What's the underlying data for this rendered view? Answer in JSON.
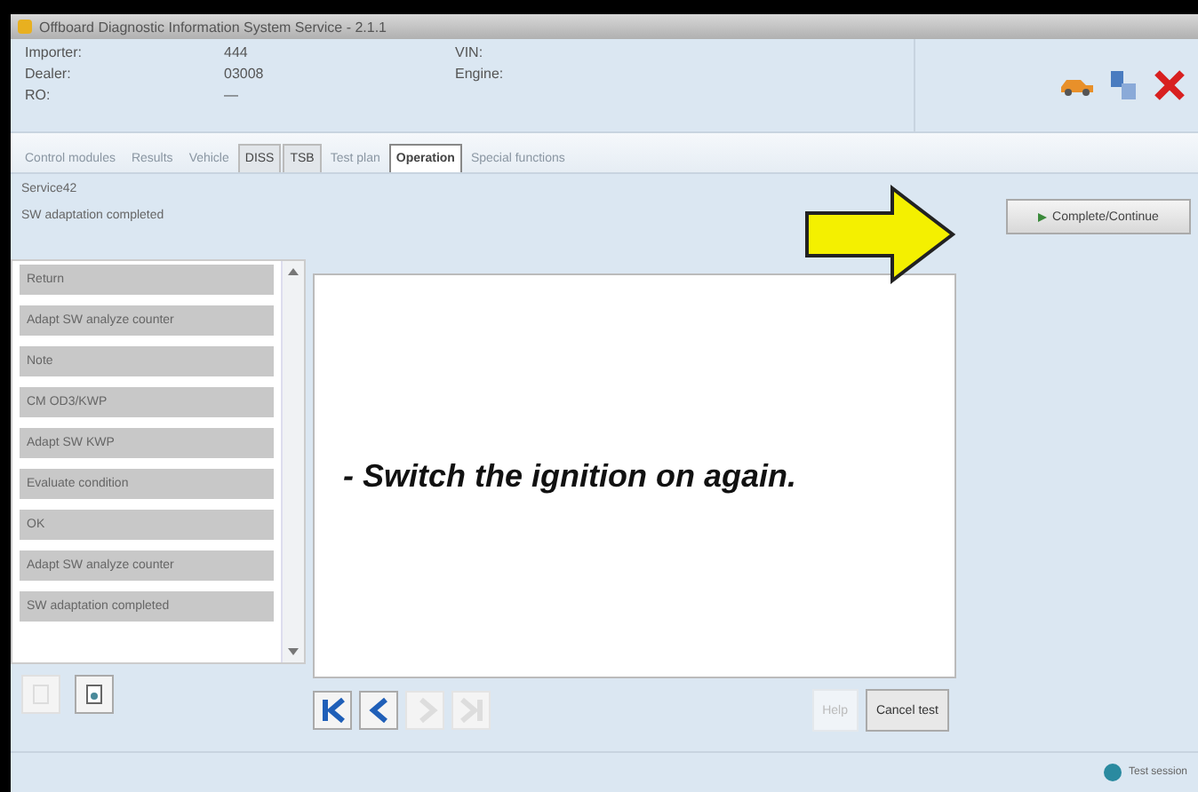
{
  "window": {
    "title": "Offboard Diagnostic Information System Service - 2.1.1"
  },
  "header": {
    "fields": [
      {
        "label": "Importer:",
        "value": "444"
      },
      {
        "label": "Dealer:",
        "value": "03008"
      },
      {
        "label": "RO:",
        "value": "—"
      }
    ],
    "vehicle_fields": [
      {
        "label": "VIN:"
      },
      {
        "label": "Engine:"
      }
    ]
  },
  "tabs": [
    {
      "label": "Control modules",
      "selected": false,
      "disabled": true
    },
    {
      "label": "Results",
      "selected": false,
      "disabled": true
    },
    {
      "label": "Vehicle",
      "selected": false,
      "disabled": true
    },
    {
      "label": "DISS",
      "selected": false,
      "disabled": false
    },
    {
      "label": "TSB",
      "selected": false,
      "disabled": false
    },
    {
      "label": "Test plan",
      "selected": false,
      "disabled": true
    },
    {
      "label": "Operation",
      "selected": true,
      "disabled": false
    },
    {
      "label": "Special functions",
      "selected": false,
      "disabled": true
    }
  ],
  "breadcrumb": {
    "title": "Service42",
    "subtitle": "SW adaptation completed"
  },
  "steps": [
    "Return",
    "Adapt SW analyze counter",
    "Note",
    "CM OD3/KWP",
    "Adapt SW KWP",
    "Evaluate condition",
    "OK",
    "Adapt SW analyze counter",
    "SW adaptation completed"
  ],
  "message": "- Switch the ignition on again.",
  "navigation": [
    {
      "kind": "first",
      "disabled": false
    },
    {
      "kind": "previous",
      "disabled": false
    },
    {
      "kind": "next",
      "disabled": true
    },
    {
      "kind": "last",
      "disabled": true
    }
  ],
  "buttons": [
    {
      "label": "Help",
      "disabled": true
    },
    {
      "label": "Cancel test",
      "disabled": false
    }
  ],
  "side_button": {
    "label": "Complete/Continue"
  },
  "status_bar": {
    "label": "Test session"
  }
}
